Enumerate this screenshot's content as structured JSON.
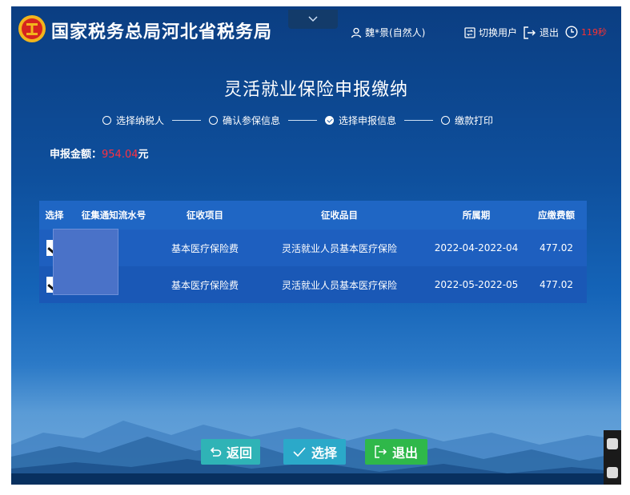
{
  "header": {
    "site_title": "国家税务总局河北省税务局",
    "user_label": "魏*景(自然人)",
    "switch_user": "切换用户",
    "logout": "退出",
    "timer": "119秒"
  },
  "page": {
    "title": "灵活就业保险申报缴纳"
  },
  "steps": [
    {
      "label": "选择纳税人",
      "done": false
    },
    {
      "label": "确认参保信息",
      "done": false
    },
    {
      "label": "选择申报信息",
      "done": true
    },
    {
      "label": "缴款打印",
      "done": false
    }
  ],
  "amount": {
    "label": "申报金额：",
    "value": "954.04",
    "unit": "元"
  },
  "table": {
    "headers": [
      "选择",
      "征集通知流水号",
      "征收项目",
      "征收品目",
      "所属期",
      "应缴费额"
    ],
    "rows": [
      {
        "item": "基本医疗保险费",
        "subitem": "灵活就业人员基本医疗保险",
        "period": "2022-04-2022-04",
        "amount": "477.02"
      },
      {
        "item": "基本医疗保险费",
        "subitem": "灵活就业人员基本医疗保险",
        "period": "2022-05-2022-05",
        "amount": "477.02"
      }
    ]
  },
  "buttons": {
    "back": "返回",
    "select": "选择",
    "exit": "退出"
  },
  "colors": {
    "accent_blue": "#1f66c4",
    "amount_red": "#ff3040",
    "exit_green": "#2fb84a"
  }
}
